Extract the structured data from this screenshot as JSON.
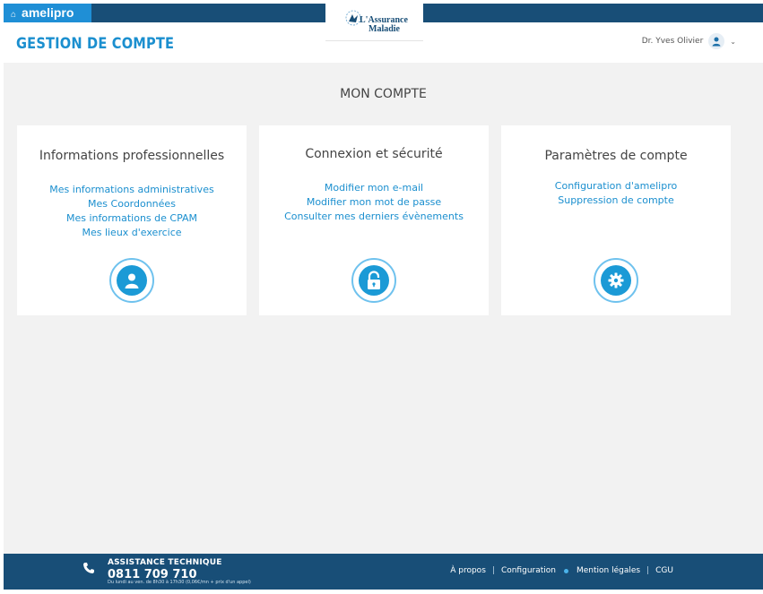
{
  "topbar": {
    "brand": "amelipro",
    "logo_line1": "L'Assurance",
    "logo_line2": "Maladie"
  },
  "header": {
    "title": "GESTION DE COMPTE",
    "user_name": "Dr. Yves Olivier"
  },
  "main": {
    "title": "MON COMPTE",
    "cards": [
      {
        "title": "Informations professionnelles",
        "links": [
          "Mes informations administratives",
          "Mes Coordonnées",
          "Mes informations de CPAM",
          "Mes lieux d'exercice"
        ],
        "icon": "user-icon"
      },
      {
        "title": "Connexion et sécurité",
        "links": [
          "Modifier mon e-mail",
          "Modifier mon mot de passe",
          "Consulter mes derniers évènements"
        ],
        "icon": "lock-icon"
      },
      {
        "title": "Paramètres de compte",
        "links": [
          "Configuration d'amelipro",
          "Suppression de compte"
        ],
        "icon": "gear-icon"
      }
    ]
  },
  "footer": {
    "assist_label": "ASSISTANCE TECHNIQUE",
    "assist_phone": "0811 709 710",
    "assist_hours": "Du lundi au ven. de 8h30 à 17h30 (0,06€/mn + prix d'un appel)",
    "links": [
      "À propos",
      "Configuration",
      "Mention légales",
      "CGU"
    ]
  },
  "colors": {
    "brand_dark": "#184e77",
    "brand_light": "#1f8fd6",
    "accent": "#1b8fcf"
  }
}
